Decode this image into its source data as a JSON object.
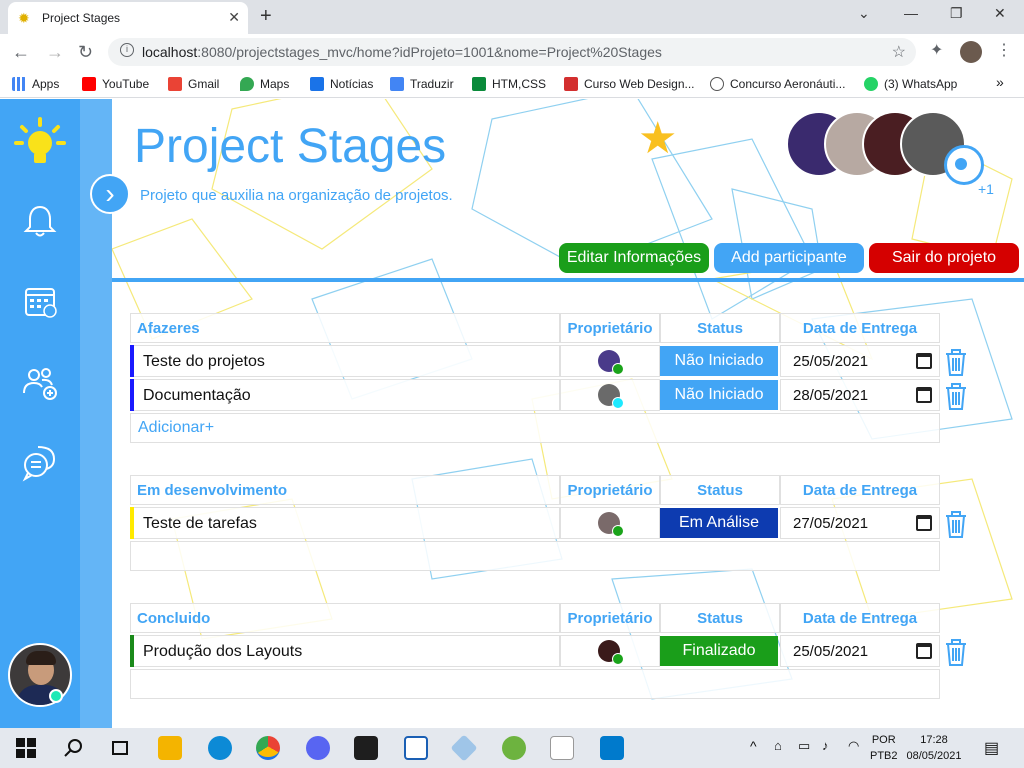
{
  "browser": {
    "tab_title": "Project Stages",
    "url_host": "localhost",
    "url_rest": ":8080/projectstages_mvc/home?idProjeto=1001&nome=Project%20Stages",
    "bookmarks": [
      "Apps",
      "YouTube",
      "Gmail",
      "Maps",
      "Notícias",
      "Traduzir",
      "HTM,CSS",
      "Curso Web Design...",
      "Concurso Aeronáuti...",
      "(3) WhatsApp"
    ],
    "bookmark_colors": [
      "#4285f4",
      "#ff0000",
      "#ea4335",
      "#34a853",
      "#1a73e8",
      "#4285f4",
      "#0a8a3a",
      "#d32f2f",
      "#555555",
      "#25d366"
    ],
    "bookmarks_more": "»"
  },
  "project": {
    "title": "Project Stages",
    "subtitle": "Projeto que auxilia na organização de projetos.",
    "participants_more": "+1",
    "participant_colors": [
      "#3a2a6e",
      "#b7a9a2",
      "#4a1e22",
      "#5a5a5a"
    ]
  },
  "actions": {
    "edit_label": "Editar Informações",
    "add_label": "Add participante",
    "leave_label": "Sair do projeto"
  },
  "columns": {
    "owner": "Proprietário",
    "status": "Status",
    "due": "Data de Entrega"
  },
  "sections": [
    {
      "name": "Afazeres",
      "add_label": "Adicionar+",
      "tasks": [
        {
          "title": "Teste do projetos",
          "status": "Não Iniciado",
          "date": "25/05/2021",
          "bar_color": "#1a1aff",
          "status_color": "#42a5f5",
          "owner_color": "#4a3a8a",
          "dot_color": "#1aa31a"
        },
        {
          "title": "Documentação",
          "status": "Não Iniciado",
          "date": "28/05/2021",
          "bar_color": "#1a1aff",
          "status_color": "#42a5f5",
          "owner_color": "#6a6a6a",
          "dot_color": "#1de9ff"
        }
      ]
    },
    {
      "name": "Em desenvolvimento",
      "tasks": [
        {
          "title": "Teste de tarefas",
          "status": "Em Análise",
          "date": "27/05/2021",
          "bar_color": "#ffea00",
          "status_color": "#0d3bb0",
          "owner_color": "#7a6a6a",
          "dot_color": "#1aa31a"
        }
      ]
    },
    {
      "name": "Concluido",
      "tasks": [
        {
          "title": "Produção dos Layouts",
          "status": "Finalizado",
          "date": "25/05/2021",
          "bar_color": "#1a8a1a",
          "status_color": "#1a9e1a",
          "owner_color": "#3a1a1a",
          "dot_color": "#1aa31a"
        }
      ]
    }
  ],
  "taskbar": {
    "lang": "POR",
    "layout": "PTB2",
    "time": "17:28",
    "date": "08/05/2021"
  }
}
